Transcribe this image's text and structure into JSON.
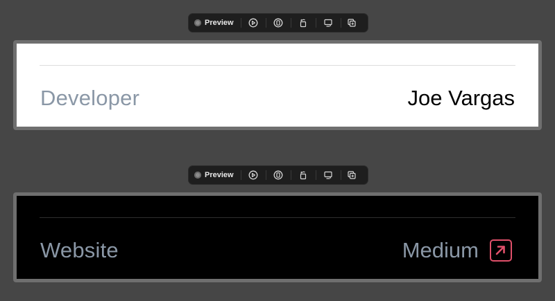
{
  "previews": [
    {
      "toolbar": {
        "preview_label": "Preview"
      },
      "row": {
        "label": "Developer",
        "value": "Joe Vargas"
      },
      "theme": {
        "background": "#ffffff",
        "label_color": "#8a97a6",
        "value_color": "#000000",
        "divider": "#dcdcdc"
      }
    },
    {
      "toolbar": {
        "preview_label": "Preview"
      },
      "row": {
        "label": "Website",
        "value": "Medium",
        "icon": "external-link-icon"
      },
      "theme": {
        "background": "#000000",
        "label_color": "#8a97a6",
        "value_color": "#8a97a6",
        "divider": "#2e2e2e",
        "accent": "#e0506a"
      }
    }
  ]
}
